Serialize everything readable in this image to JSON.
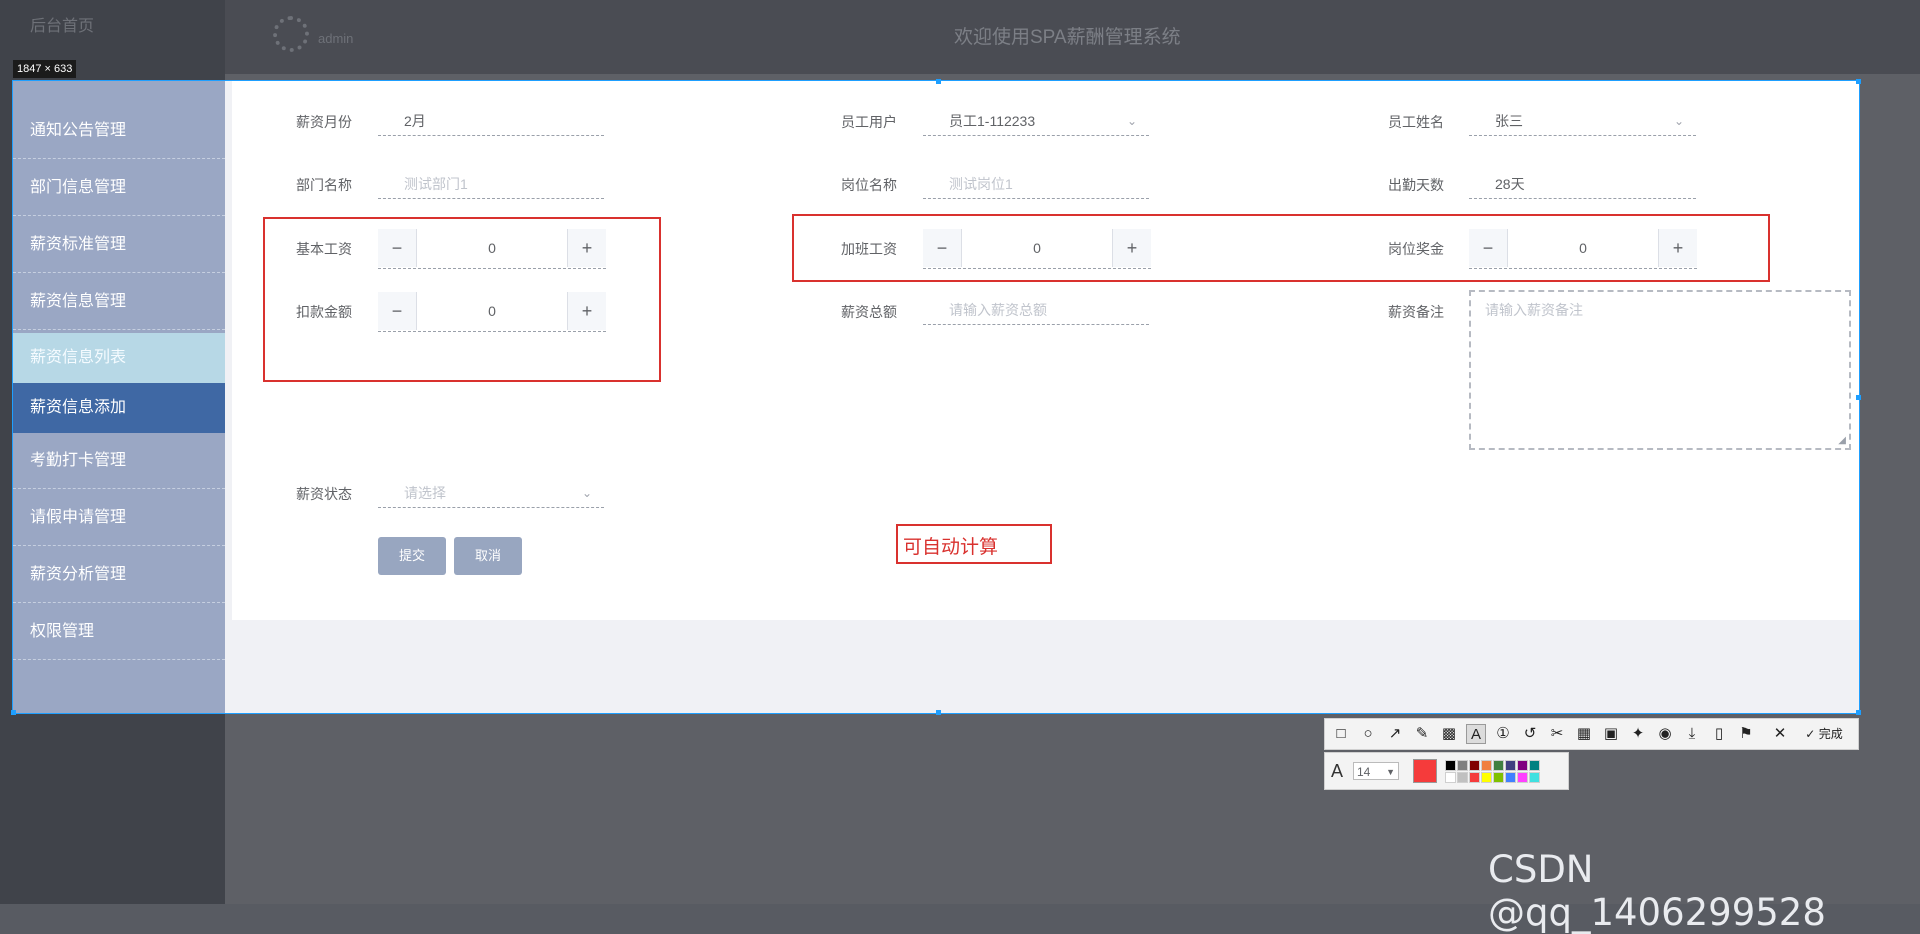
{
  "app": {
    "top_left_menu": "后台首页",
    "header_title": "欢迎使用SPA薪酬管理系统",
    "username": "admin"
  },
  "capture": {
    "size_label": "1847 × 633",
    "sidebar_items": [
      {
        "label": "通知公告管理"
      },
      {
        "label": "部门信息管理"
      },
      {
        "label": "薪资标准管理"
      },
      {
        "label": "薪资信息管理"
      },
      {
        "label": "薪资信息列表"
      },
      {
        "label": "薪资信息添加"
      },
      {
        "label": "考勤打卡管理"
      },
      {
        "label": "请假申请管理"
      },
      {
        "label": "薪资分析管理"
      },
      {
        "label": "权限管理"
      }
    ]
  },
  "form": {
    "month_label": "薪资月份",
    "month_value": "2月",
    "user_label": "员工用户",
    "user_value": "员工1-112233",
    "name_label": "员工姓名",
    "name_value": "张三",
    "dept_label": "部门名称",
    "dept_value": "测试部门1",
    "post_label": "岗位名称",
    "post_value": "测试岗位1",
    "attendance_label": "出勤天数",
    "attendance_value": "28天",
    "base_label": "基本工资",
    "base_value": "0",
    "overtime_label": "加班工资",
    "overtime_value": "0",
    "bonus_label": "岗位奖金",
    "bonus_value": "0",
    "deduct_label": "扣款金额",
    "deduct_value": "0",
    "total_label": "薪资总额",
    "total_placeholder": "请输入薪资总额",
    "remark_label": "薪资备注",
    "remark_placeholder": "请输入薪资备注",
    "status_label": "薪资状态",
    "status_placeholder": "请选择",
    "submit_label": "提交",
    "cancel_label": "取消"
  },
  "annotation": {
    "text": "可自动计算",
    "color": "#d9312e"
  },
  "toolbar": {
    "done_label": "完成",
    "font_size": "14",
    "active_color": "#f53b3b",
    "palette": [
      "#000000",
      "#808080",
      "#800000",
      "#f08040",
      "#408040",
      "#404080",
      "#800080",
      "#008080",
      "#ffffff",
      "#c0c0c0",
      "#f53b3b",
      "#ffff00",
      "#80c000",
      "#4080ff",
      "#ff40ff",
      "#40e0e0"
    ]
  },
  "watermark": "CSDN @qq_1406299528"
}
